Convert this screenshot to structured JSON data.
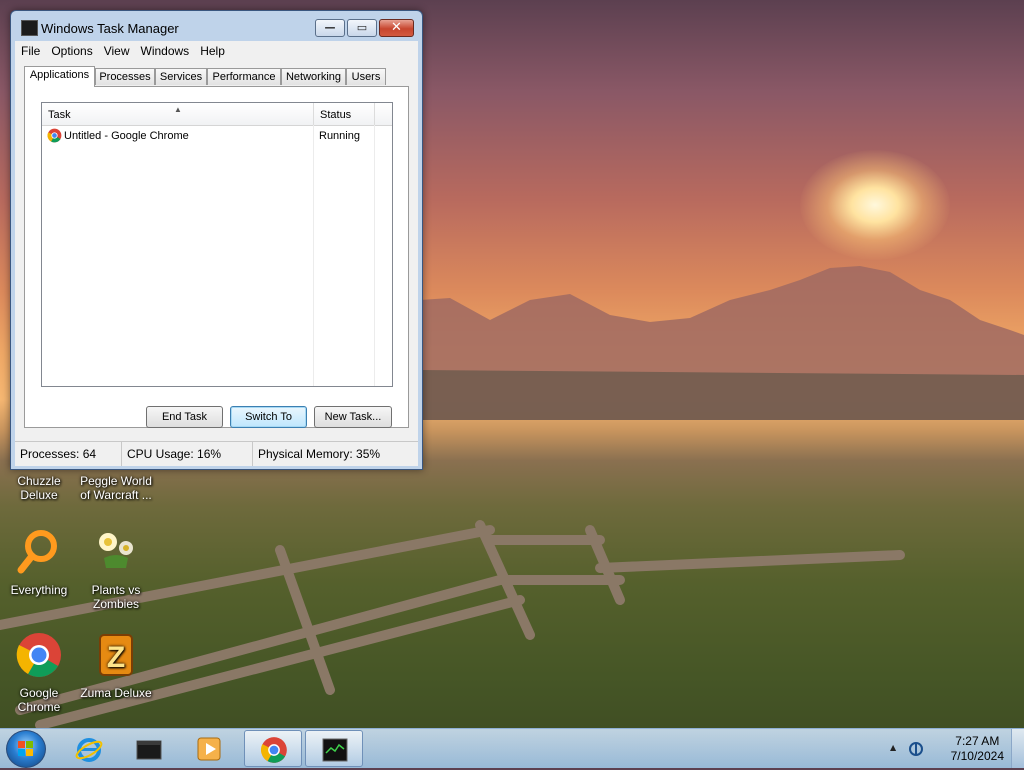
{
  "window": {
    "title": "Windows Task Manager",
    "buttons": {
      "minimize": "—",
      "maximize": "▭",
      "close": "✕"
    },
    "menu": [
      "File",
      "Options",
      "View",
      "Windows",
      "Help"
    ],
    "tabs": [
      "Applications",
      "Processes",
      "Services",
      "Performance",
      "Networking",
      "Users"
    ],
    "active_tab": "Applications",
    "columns": {
      "task": "Task",
      "status": "Status"
    },
    "rows": [
      {
        "task": "Untitled - Google Chrome",
        "status": "Running",
        "icon": "chrome-icon"
      }
    ],
    "actions": {
      "end_task": "End Task",
      "switch_to": "Switch To",
      "new_task": "New Task..."
    },
    "statusbar": {
      "processes": "Processes: 64",
      "cpu": "CPU Usage: 16%",
      "memory": "Physical Memory: 35%"
    }
  },
  "desktop_icons": [
    {
      "label": "Chuzzle Deluxe",
      "icon": "chuzzle-icon"
    },
    {
      "label": "Peggle World of Warcraft ...",
      "icon": "peggle-icon"
    },
    {
      "label": "Everything",
      "icon": "everything-search-icon"
    },
    {
      "label": "Plants vs Zombies",
      "icon": "plants-vs-zombies-icon"
    },
    {
      "label": "Google Chrome",
      "icon": "chrome-icon"
    },
    {
      "label": "Zuma Deluxe",
      "icon": "zuma-icon"
    }
  ],
  "taskbar": {
    "items": [
      "internet-explorer-icon",
      "terminal-icon",
      "media-player-icon",
      "chrome-icon",
      "task-manager-icon"
    ],
    "tray_chevron": "▲",
    "time": "7:27 AM",
    "date": "7/10/2024"
  },
  "colors": {
    "accent": "#3c7fb1",
    "close_button": "#c7462f",
    "taskbar": "#a0c3e6"
  }
}
